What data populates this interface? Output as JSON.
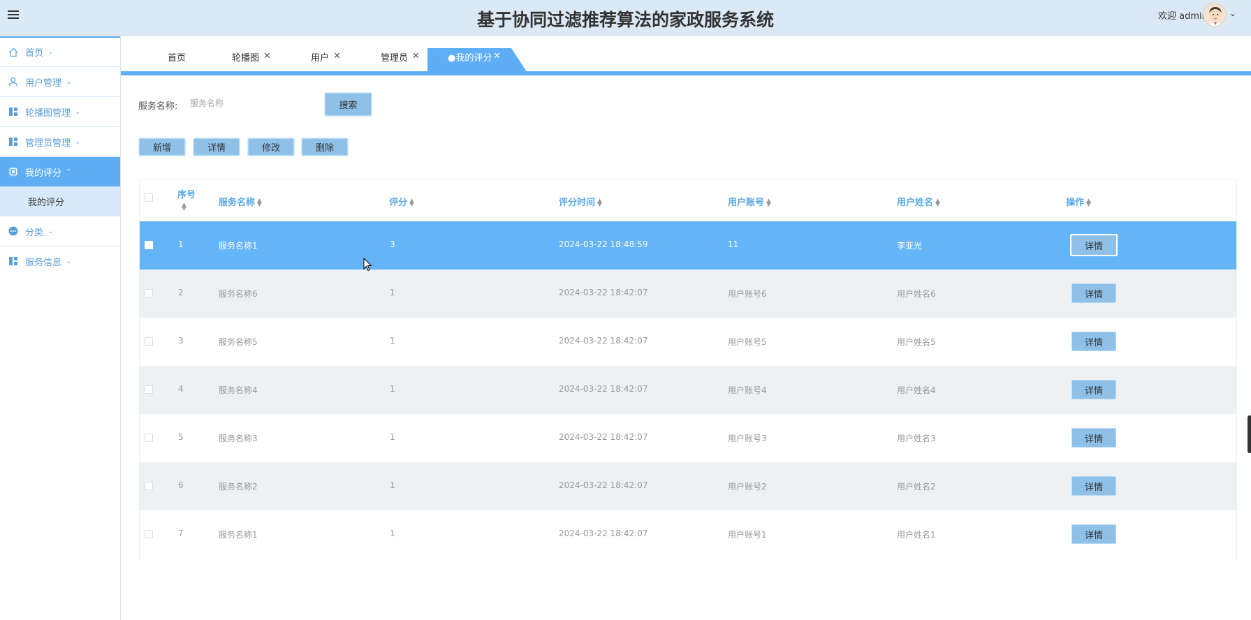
{
  "header": {
    "title": "基于协同过滤推荐算法的家政服务系统",
    "welcome": "欢迎 admin",
    "bg_color": "#dbe9f6"
  },
  "sidebar": {
    "items": [
      {
        "label": "首页",
        "icon": "home-icon"
      },
      {
        "label": "用户管理",
        "icon": "user-icon"
      },
      {
        "label": "轮播图管理",
        "icon": "dashboard-icon"
      },
      {
        "label": "管理员管理",
        "icon": "dashboard-icon"
      },
      {
        "label": "我的评分",
        "icon": "chip-icon",
        "active": true,
        "sub": "我的评分"
      },
      {
        "label": "分类",
        "icon": "more-icon"
      },
      {
        "label": "服务信息",
        "icon": "dashboard-icon"
      }
    ],
    "accent": "#5daef5"
  },
  "tabs": [
    {
      "label": "首页",
      "closable": false
    },
    {
      "label": "轮播图",
      "closable": true
    },
    {
      "label": "用户",
      "closable": true
    },
    {
      "label": "管理员",
      "closable": true
    },
    {
      "label": "●我的评分",
      "closable": true,
      "active": true
    }
  ],
  "search": {
    "label": "服务名称:",
    "placeholder": "服务名称",
    "button": "搜索"
  },
  "actions": {
    "add": "新增",
    "detail": "详情",
    "edit": "修改",
    "delete": "删除"
  },
  "table": {
    "headers": {
      "index": "序号",
      "service_name": "服务名称",
      "score": "评分",
      "time": "评分时间",
      "account": "用户账号",
      "username": "用户姓名",
      "ops": "操作"
    },
    "detail_label": "详情",
    "rows": [
      {
        "index": "1",
        "service_name": "服务名称1",
        "score": "3",
        "time": "2024-03-22 18:48:59",
        "account": "11",
        "username": "李亚光",
        "selected": true
      },
      {
        "index": "2",
        "service_name": "服务名称6",
        "score": "1",
        "time": "2024-03-22 18:42:07",
        "account": "用户账号6",
        "username": "用户姓名6"
      },
      {
        "index": "3",
        "service_name": "服务名称5",
        "score": "1",
        "time": "2024-03-22 18:42:07",
        "account": "用户账号5",
        "username": "用户姓名5"
      },
      {
        "index": "4",
        "service_name": "服务名称4",
        "score": "1",
        "time": "2024-03-22 18:42:07",
        "account": "用户账号4",
        "username": "用户姓名4"
      },
      {
        "index": "5",
        "service_name": "服务名称3",
        "score": "1",
        "time": "2024-03-22 18:42:07",
        "account": "用户账号3",
        "username": "用户姓名3"
      },
      {
        "index": "6",
        "service_name": "服务名称2",
        "score": "1",
        "time": "2024-03-22 18:42:07",
        "account": "用户账号2",
        "username": "用户姓名2"
      },
      {
        "index": "7",
        "service_name": "服务名称1",
        "score": "1",
        "time": "2024-03-22 18:42:07",
        "account": "用户账号1",
        "username": "用户姓名1"
      }
    ],
    "selected_color": "#64b4f8"
  }
}
